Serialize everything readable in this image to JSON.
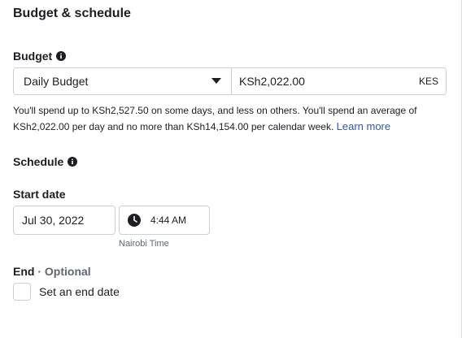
{
  "section": {
    "title": "Budget & schedule"
  },
  "budget": {
    "label": "Budget",
    "type_value": "Daily Budget",
    "amount_value": "KSh2,022.00",
    "currency": "KES",
    "hint_text": "You'll spend up to KSh2,527.50 on some days, and less on others. You'll spend an average of KSh2,022.00 per day and no more than KSh14,154.00 per calendar week.",
    "learn_more": "Learn more"
  },
  "schedule": {
    "label": "Schedule",
    "start_label": "Start date",
    "start_date": "Jul 30, 2022",
    "start_time": "4:44 AM",
    "timezone": "Nairobi Time",
    "end_label": "End",
    "end_separator": " · ",
    "end_optional": "Optional",
    "end_checkbox_label": "Set an end date",
    "end_checked": false
  },
  "icons": {
    "info": "info-icon",
    "caret": "caret-down-icon",
    "clock": "clock-icon"
  },
  "colors": {
    "link": "#385898",
    "border": "#ccd0d5",
    "muted": "#606770",
    "text": "#1c1e21"
  }
}
